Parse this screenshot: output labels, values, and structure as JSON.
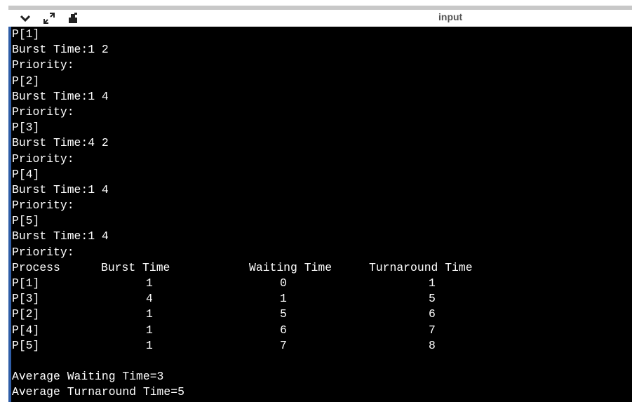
{
  "toolbar": {
    "title": "input",
    "icons": [
      "chevron-down-icon",
      "expand-icon",
      "clear-icon"
    ]
  },
  "terminal": {
    "input_lines": [
      "P[1]",
      "Burst Time:1 2",
      "Priority:",
      "P[2]",
      "Burst Time:1 4",
      "Priority:",
      "P[3]",
      "Burst Time:4 2",
      "Priority:",
      "P[4]",
      "Burst Time:1 4",
      "Priority:",
      "P[5]",
      "Burst Time:1 4",
      "Priority:"
    ],
    "table": {
      "headers": [
        "Process",
        "Burst Time",
        "Waiting Time",
        "Turnaround Time"
      ],
      "rows": [
        [
          "P[1]",
          "1",
          "0",
          "1"
        ],
        [
          "P[3]",
          "4",
          "1",
          "5"
        ],
        [
          "P[2]",
          "1",
          "5",
          "6"
        ],
        [
          "P[4]",
          "1",
          "6",
          "7"
        ],
        [
          "P[5]",
          "1",
          "7",
          "8"
        ]
      ]
    },
    "summary": {
      "avg_waiting": "Average Waiting Time=3",
      "avg_turnaround": "Average Turnaround Time=5"
    }
  }
}
